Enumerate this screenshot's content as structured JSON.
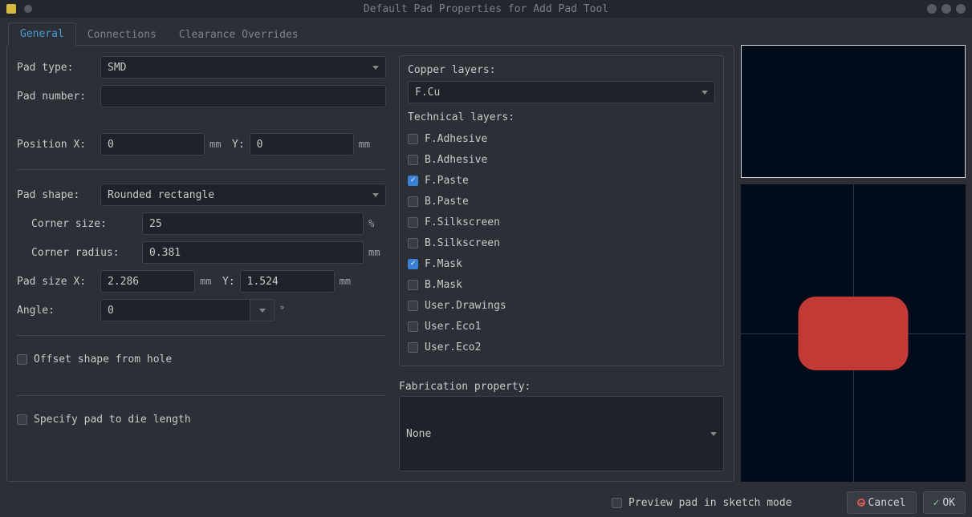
{
  "window": {
    "title": "Default Pad Properties for Add Pad Tool"
  },
  "tabs": [
    "General",
    "Connections",
    "Clearance Overrides"
  ],
  "active_tab": 0,
  "left": {
    "pad_type_label": "Pad type:",
    "pad_type_value": "SMD",
    "pad_number_label": "Pad number:",
    "pad_number_value": "",
    "position_x_label": "Position X:",
    "position_x_value": "0",
    "position_y_label": "Y:",
    "position_y_value": "0",
    "mm": "mm",
    "pad_shape_label": "Pad shape:",
    "pad_shape_value": "Rounded rectangle",
    "corner_size_label": "Corner size:",
    "corner_size_value": "25",
    "percent": "%",
    "corner_radius_label": "Corner radius:",
    "corner_radius_value": "0.381",
    "pad_size_x_label": "Pad size X:",
    "pad_size_x_value": "2.286",
    "pad_size_y_label": "Y:",
    "pad_size_y_value": "1.524",
    "angle_label": "Angle:",
    "angle_value": "0",
    "degree": "°",
    "offset_label": "Offset shape from hole",
    "offset_checked": false,
    "specify_label": "Specify pad to die length",
    "specify_checked": false
  },
  "right": {
    "copper_layers_label": "Copper layers:",
    "copper_layers_value": "F.Cu",
    "technical_layers_label": "Technical layers:",
    "layers": [
      {
        "name": "F.Adhesive",
        "checked": false
      },
      {
        "name": "B.Adhesive",
        "checked": false
      },
      {
        "name": "F.Paste",
        "checked": true
      },
      {
        "name": "B.Paste",
        "checked": false
      },
      {
        "name": "F.Silkscreen",
        "checked": false
      },
      {
        "name": "B.Silkscreen",
        "checked": false
      },
      {
        "name": "F.Mask",
        "checked": true
      },
      {
        "name": "B.Mask",
        "checked": false
      },
      {
        "name": "User.Drawings",
        "checked": false
      },
      {
        "name": "User.Eco1",
        "checked": false
      },
      {
        "name": "User.Eco2",
        "checked": false
      }
    ],
    "fab_prop_label": "Fabrication property:",
    "fab_prop_value": "None"
  },
  "footer": {
    "preview_label": "Preview pad in sketch mode",
    "preview_checked": false,
    "cancel": "Cancel",
    "ok": "OK"
  }
}
